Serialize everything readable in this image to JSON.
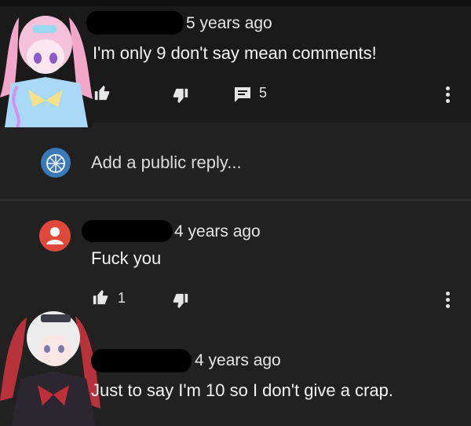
{
  "comments": [
    {
      "time": "5 years ago",
      "text": "I'm only 9 don't say mean comments!",
      "reply_count": "5"
    },
    {
      "time": "4 years ago",
      "text": "Fuck you",
      "like_count": "1"
    },
    {
      "time": "4 years ago",
      "text": "Just to say I'm 10 so I don't give a crap."
    }
  ],
  "reply_box": {
    "placeholder": "Add a public reply..."
  },
  "icons": {
    "like": "thumbs-up-icon",
    "dislike": "thumbs-down-icon",
    "replies": "comment-icon",
    "menu": "more-vertical-icon"
  },
  "colors": {
    "background": "#212121",
    "highlight": "#1a1a1a",
    "text": "#f1f1f1",
    "avatar_red": "#e0483c"
  }
}
